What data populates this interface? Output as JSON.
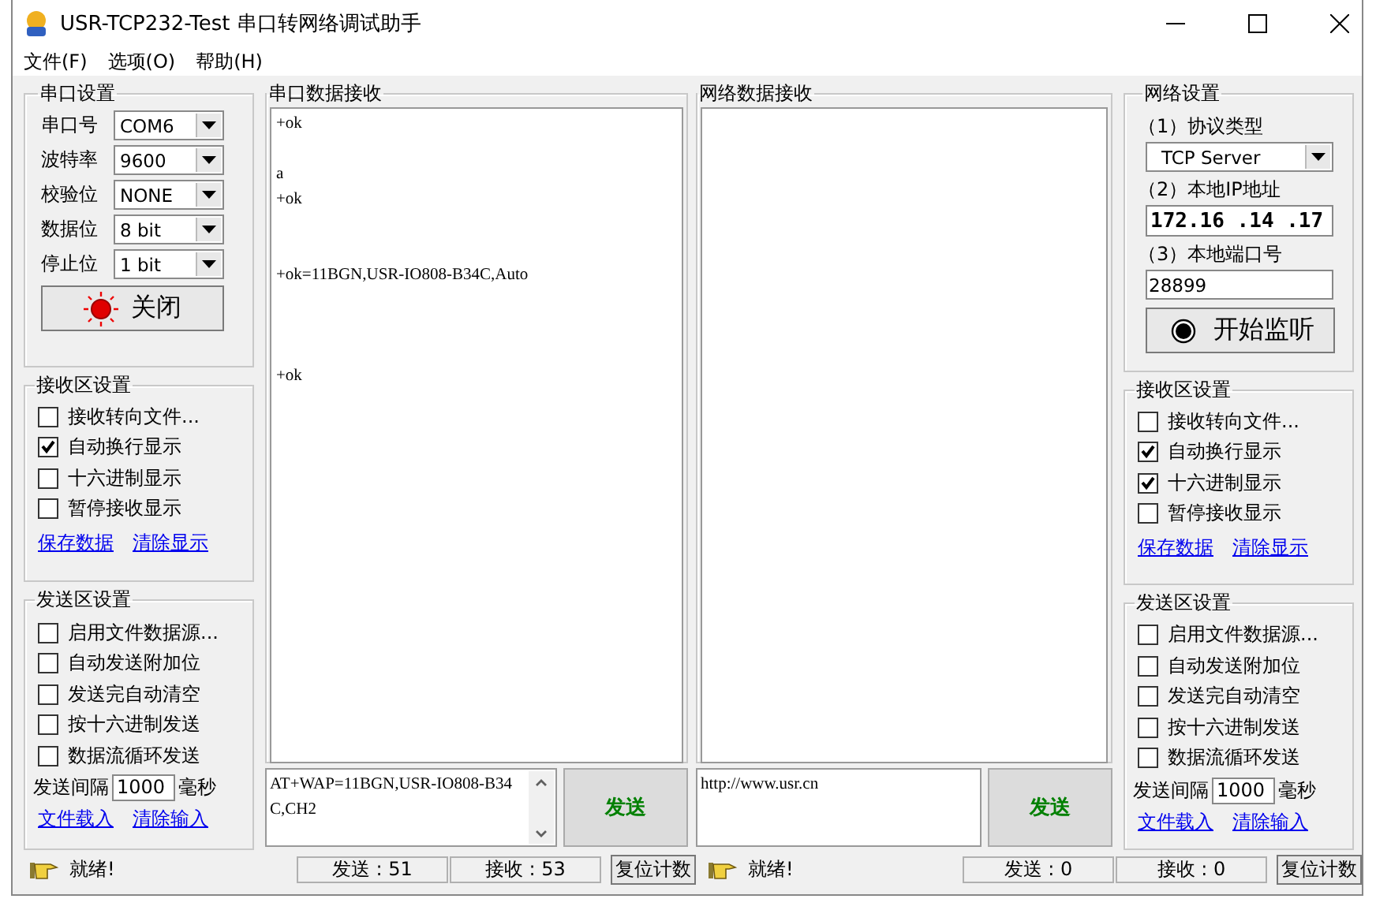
{
  "window": {
    "title": "USR-TCP232-Test 串口转网络调试助手"
  },
  "menu": [
    "文件(F)",
    "选项(O)",
    "帮助(H)"
  ],
  "serial_side": {
    "settings": {
      "title": "串口设置",
      "fields": [
        {
          "label": "串口号",
          "value": "COM6"
        },
        {
          "label": "波特率",
          "value": "9600"
        },
        {
          "label": "校验位",
          "value": "NONE"
        },
        {
          "label": "数据位",
          "value": "8 bit"
        },
        {
          "label": "停止位",
          "value": "1 bit"
        }
      ],
      "button": {
        "label": "关闭",
        "active": true
      }
    },
    "receive_settings": {
      "title": "接收区设置",
      "options": [
        {
          "label": "接收转向文件...",
          "checked": false
        },
        {
          "label": "自动换行显示",
          "checked": true
        },
        {
          "label": "十六进制显示",
          "checked": false
        },
        {
          "label": "暂停接收显示",
          "checked": false
        }
      ],
      "links": [
        "保存数据",
        "清除显示"
      ]
    },
    "send_settings": {
      "title": "发送区设置",
      "options": [
        {
          "label": "启用文件数据源...",
          "checked": false
        },
        {
          "label": "自动发送附加位",
          "checked": false
        },
        {
          "label": "发送完自动清空",
          "checked": false
        },
        {
          "label": "按十六进制发送",
          "checked": false
        },
        {
          "label": "数据流循环发送",
          "checked": false
        }
      ],
      "interval_label": "发送间隔",
      "interval": "1000",
      "interval_unit": "毫秒",
      "links": [
        "文件载入",
        "清除输入"
      ]
    },
    "receive_area": {
      "title": "串口数据接收",
      "text": "+ok\n\na\n+ok\n\n\n+ok=11BGN,USR-IO808-B34C,Auto\n\n\n\n+ok"
    },
    "send_area": {
      "text": "AT+WAP=11BGN,USR-IO808-B34C,CH2",
      "has_scrollbar": true,
      "button": "发送"
    },
    "status": {
      "message": "就绪!",
      "sent": "发送 : 51",
      "received": "接收 : 53",
      "reset": "复位计数"
    }
  },
  "network_side": {
    "settings": {
      "title": "网络设置",
      "protocol_label": "（1）协议类型",
      "protocol": "TCP Server",
      "ip_label": "（2）本地IP地址",
      "ip": "172.16 .14 .17",
      "port_label": "（3）本地端口号",
      "port": "28899",
      "button": {
        "label": "开始监听",
        "active": false
      }
    },
    "receive_settings": {
      "title": "接收区设置",
      "options": [
        {
          "label": "接收转向文件...",
          "checked": false
        },
        {
          "label": "自动换行显示",
          "checked": true
        },
        {
          "label": "十六进制显示",
          "checked": true
        },
        {
          "label": "暂停接收显示",
          "checked": false
        }
      ],
      "links": [
        "保存数据",
        "清除显示"
      ]
    },
    "send_settings": {
      "title": "发送区设置",
      "options": [
        {
          "label": "启用文件数据源...",
          "checked": false
        },
        {
          "label": "自动发送附加位",
          "checked": false
        },
        {
          "label": "发送完自动清空",
          "checked": false
        },
        {
          "label": "按十六进制发送",
          "checked": false
        },
        {
          "label": "数据流循环发送",
          "checked": false
        }
      ],
      "interval_label": "发送间隔",
      "interval": "1000",
      "interval_unit": "毫秒",
      "links": [
        "文件载入",
        "清除输入"
      ]
    },
    "receive_area": {
      "title": "网络数据接收"
    },
    "send_area": {
      "text": "http://www.usr.cn",
      "has_scrollbar": false,
      "button": "发送"
    },
    "status": {
      "message": "就绪!",
      "sent": "发送 : 0",
      "received": "接收 : 0",
      "reset": "复位计数"
    }
  }
}
